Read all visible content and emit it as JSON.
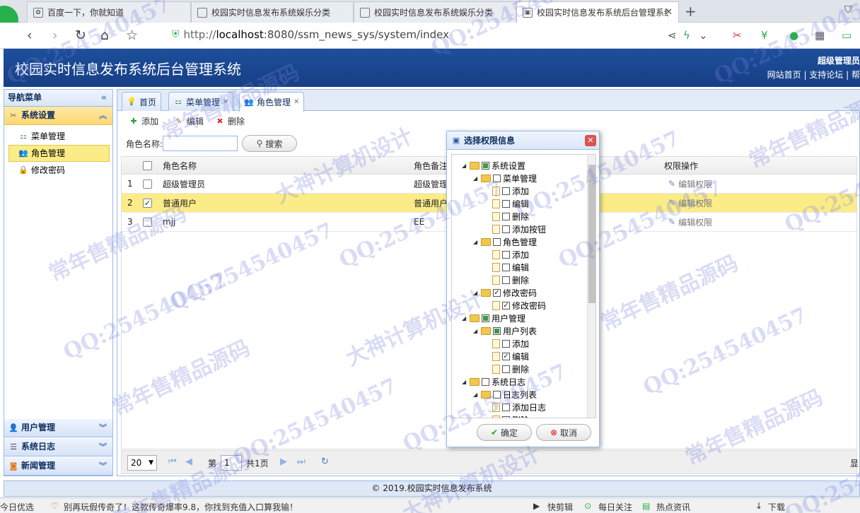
{
  "browser": {
    "tabs": [
      {
        "title": "百度一下，你就知道",
        "active": false
      },
      {
        "title": "校园实时信息发布系统娱乐分类",
        "active": false
      },
      {
        "title": "校园实时信息发布系统娱乐分类",
        "active": false
      },
      {
        "title": "校园实时信息发布系统后台管理系统",
        "active": true
      }
    ],
    "url_scheme": "http://",
    "url_host": "localhost",
    "url_rest": ":8080/ssm_news_sys/system/index"
  },
  "header": {
    "title": "校园实时信息发布系统后台管理系统",
    "user": "超级管理员",
    "links": [
      "网站首页",
      "支持论坛",
      "帮"
    ]
  },
  "sidebar": {
    "title": "导航菜单",
    "groups": [
      {
        "label": "系统设置",
        "open": true,
        "items": [
          "菜单管理",
          "角色管理",
          "修改密码"
        ]
      },
      {
        "label": "用户管理",
        "open": false
      },
      {
        "label": "系统日志",
        "open": false
      },
      {
        "label": "新闻管理",
        "open": false
      }
    ],
    "selected_item": "角色管理"
  },
  "tabs": [
    {
      "label": "首页",
      "closable": false
    },
    {
      "label": "菜单管理",
      "closable": true
    },
    {
      "label": "角色管理",
      "closable": true,
      "active": true
    }
  ],
  "toolbar": {
    "add": "添加",
    "edit": "编辑",
    "delete": "删除"
  },
  "search": {
    "label": "角色名称:",
    "value": "",
    "button": "搜索"
  },
  "grid": {
    "columns": [
      "角色名称",
      "角色备注",
      "权限操作"
    ],
    "rows": [
      {
        "num": "1",
        "checked": false,
        "name": "超级管理员",
        "remark": "超级管理",
        "perm": "编辑权限",
        "selected": false
      },
      {
        "num": "2",
        "checked": true,
        "name": "普通用户",
        "remark": "普通用户",
        "perm": "编辑权限",
        "selected": true
      },
      {
        "num": "3",
        "checked": false,
        "name": "mjj",
        "remark": "EE",
        "perm": "编辑权限",
        "selected": false
      }
    ]
  },
  "pager": {
    "page_size": "20",
    "page_label": "第",
    "page": "1",
    "total": "共1页",
    "right_text": "显"
  },
  "footer": "© 2019.校园实时信息发布系统",
  "statusbar": {
    "left": "今日优选",
    "news": "别再玩假传奇了！这款传奇爆率9.8，你找到充值入口算我输！",
    "items": [
      "快剪辑",
      "每日关注",
      "热点资讯",
      "下载"
    ]
  },
  "dialog": {
    "title": "选择权限信息",
    "ok": "确定",
    "cancel": "取消",
    "tree": [
      {
        "label": "系统设置",
        "level": 0,
        "type": "folder",
        "state": "partial"
      },
      {
        "label": "菜单管理",
        "level": 1,
        "type": "folder",
        "state": "unchecked"
      },
      {
        "label": "添加",
        "level": 2,
        "type": "leaf",
        "state": "unchecked"
      },
      {
        "label": "编辑",
        "level": 2,
        "type": "leaf",
        "state": "unchecked"
      },
      {
        "label": "删除",
        "level": 2,
        "type": "leaf",
        "state": "unchecked"
      },
      {
        "label": "添加按钮",
        "level": 2,
        "type": "leaf",
        "state": "unchecked"
      },
      {
        "label": "角色管理",
        "level": 1,
        "type": "folder",
        "state": "unchecked"
      },
      {
        "label": "添加",
        "level": 2,
        "type": "leaf",
        "state": "unchecked"
      },
      {
        "label": "编辑",
        "level": 2,
        "type": "leaf",
        "state": "unchecked"
      },
      {
        "label": "删除",
        "level": 2,
        "type": "leaf",
        "state": "unchecked"
      },
      {
        "label": "修改密码",
        "level": 1,
        "type": "folder",
        "state": "checked"
      },
      {
        "label": "修改密码",
        "level": 2,
        "type": "leaf",
        "state": "checked"
      },
      {
        "label": "用户管理",
        "level": 0,
        "type": "folder",
        "state": "partial"
      },
      {
        "label": "用户列表",
        "level": 1,
        "type": "folder",
        "state": "partial"
      },
      {
        "label": "添加",
        "level": 2,
        "type": "leaf",
        "state": "unchecked"
      },
      {
        "label": "编辑",
        "level": 2,
        "type": "leaf",
        "state": "checked"
      },
      {
        "label": "删除",
        "level": 2,
        "type": "leaf",
        "state": "unchecked"
      },
      {
        "label": "系统日志",
        "level": 0,
        "type": "folder",
        "state": "unchecked"
      },
      {
        "label": "日志列表",
        "level": 1,
        "type": "folder",
        "state": "unchecked"
      },
      {
        "label": "添加日志",
        "level": 2,
        "type": "leaf",
        "state": "unchecked"
      },
      {
        "label": "删除",
        "level": 2,
        "type": "leaf",
        "state": "unchecked"
      }
    ]
  },
  "watermarks": [
    "QQ:254540457",
    "常年售精品源码",
    "大神计算机设计"
  ],
  "colors": {
    "header_bg": "#1d4f9c",
    "selection": "#fbec88",
    "panel_border": "#99bbe8"
  }
}
